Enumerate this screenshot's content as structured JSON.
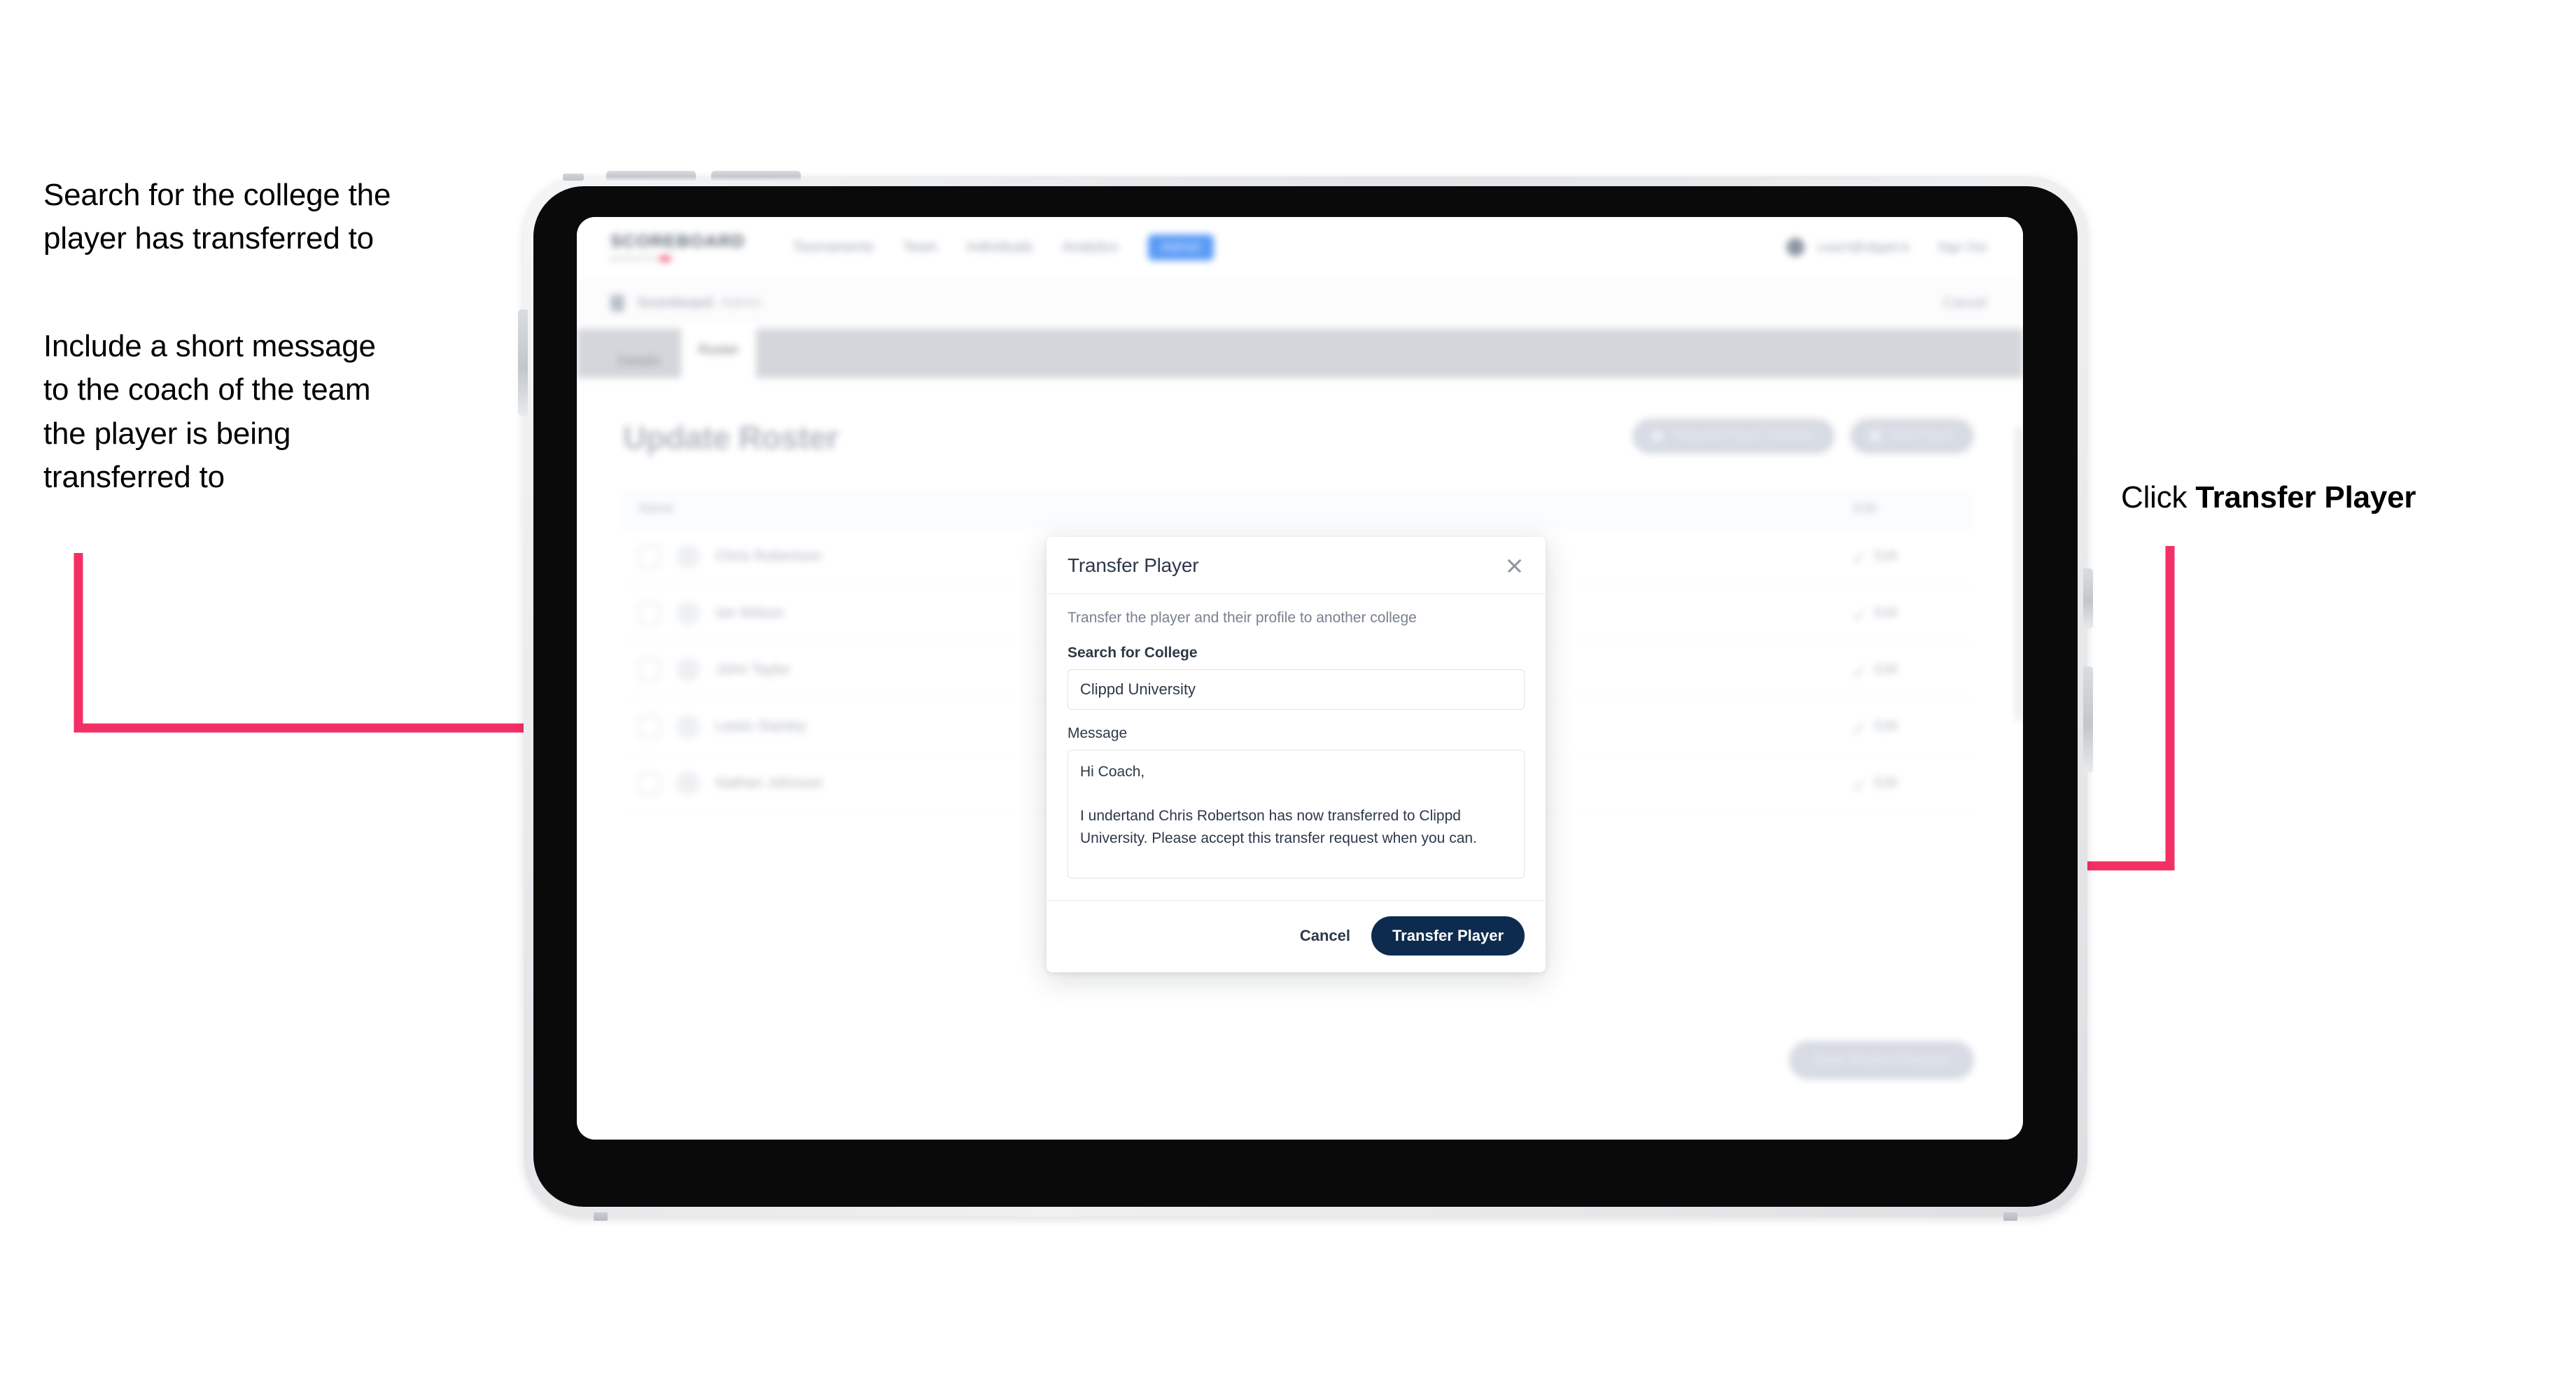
{
  "annotations": {
    "left_1": "Search for the college the\nplayer has transferred to",
    "left_2": "Include a short message\nto the coach of the team\nthe player is being\ntransferred to",
    "right_prefix": "Click ",
    "right_bold": "Transfer Player"
  },
  "colors": {
    "arrow_pink": "#f23065",
    "primary_navy": "#0d2b4e",
    "nav_pill_blue": "#5a9bf6",
    "brand_accent": "#ef4a73"
  },
  "app": {
    "brand": {
      "name": "SCOREBOARD",
      "tagline": "powered by",
      "accent_label": "clippd"
    },
    "nav_links": [
      {
        "label": "Tournaments"
      },
      {
        "label": "Team"
      },
      {
        "label": "Individuals"
      },
      {
        "label": "Analytics"
      },
      {
        "label": "Admin",
        "style": "pill"
      }
    ],
    "nav_right": {
      "avatar": "avatar-icon",
      "user": "coach@clippd.io",
      "sign_out": "Sign Out"
    },
    "breadcrumb": {
      "icon": "scoreboard-icon",
      "title": "Scoreboard",
      "muted": "Admin",
      "cancel": "Cancel"
    },
    "tabs": [
      {
        "label": "Details",
        "active": false
      },
      {
        "label": "Roster",
        "active": true
      }
    ],
    "page": {
      "title": "Update Roster",
      "actions": [
        {
          "label": "Request Player Transfer",
          "icon": "transfer-icon"
        },
        {
          "label": "Add Player",
          "icon": "plus-icon"
        }
      ],
      "save_label": "Save Roster Changes"
    },
    "roster": {
      "columns": [
        "Name",
        "Edit"
      ],
      "rows": [
        {
          "name": "Chris Robertson",
          "edit": "Edit"
        },
        {
          "name": "Ian Wilson",
          "edit": "Edit"
        },
        {
          "name": "John Taylor",
          "edit": "Edit"
        },
        {
          "name": "Lewis Stanley",
          "edit": "Edit"
        },
        {
          "name": "Nathan Johnson",
          "edit": "Edit"
        }
      ]
    }
  },
  "modal": {
    "title": "Transfer Player",
    "close_icon": "close-icon",
    "description": "Transfer the player and their profile to another college",
    "college_field": {
      "label": "Search for College",
      "value": "Clippd University",
      "placeholder": "Search for College"
    },
    "message_field": {
      "label": "Message",
      "value": "Hi Coach,\n\nI undertand Chris Robertson has now transferred to Clippd University. Please accept this transfer request when you can.",
      "placeholder": "Message"
    },
    "cancel_label": "Cancel",
    "submit_label": "Transfer Player"
  }
}
